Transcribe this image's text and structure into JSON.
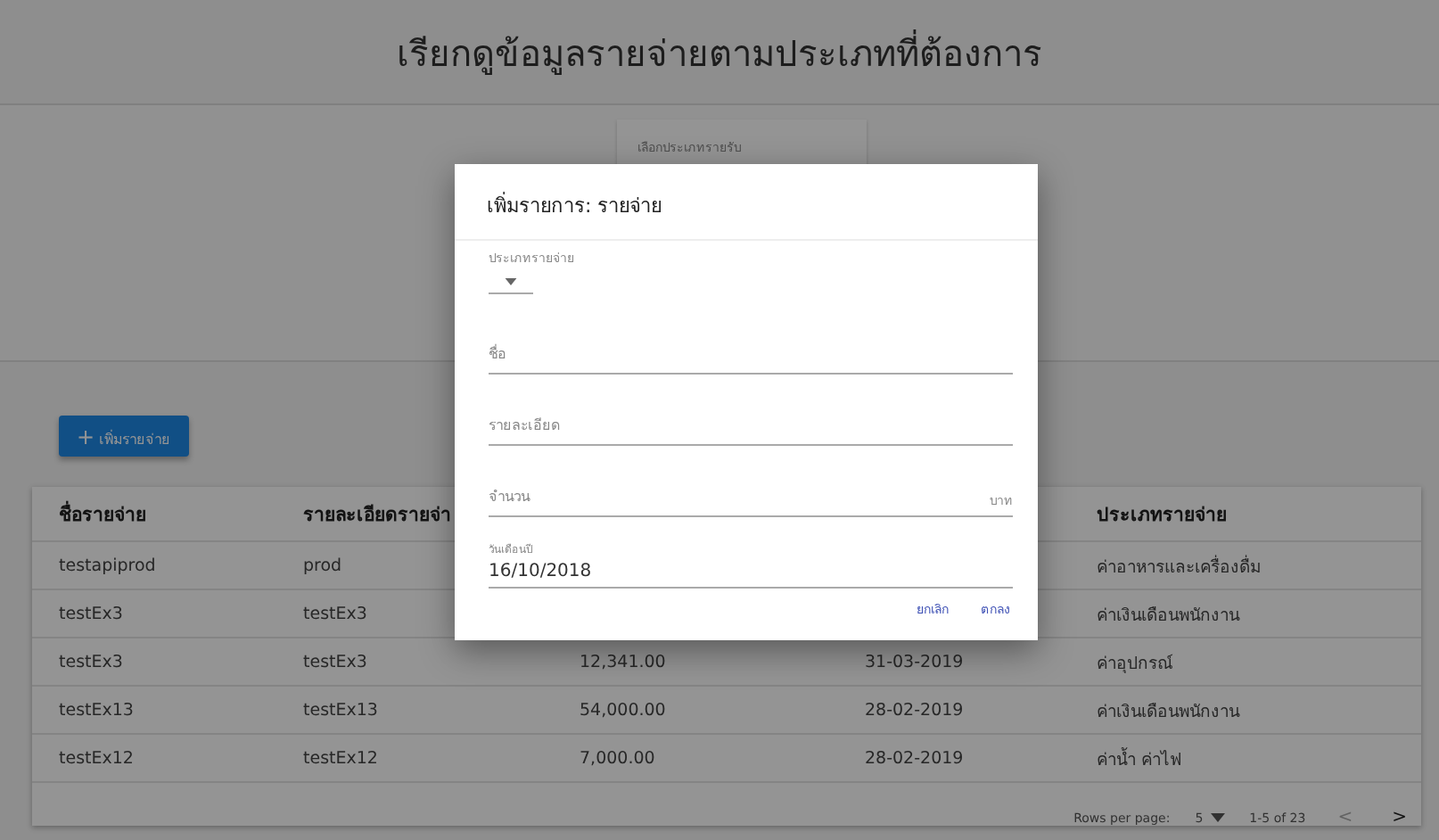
{
  "page_title": "เรียกดูข้อมูลรายจ่ายตามประเภทที่ต้องการ",
  "filter": {
    "label": "เลือกประเภทรายรับ"
  },
  "add_button": {
    "icon": "+",
    "label": "เพิ่มรายจ่าย"
  },
  "table": {
    "columns": [
      "ชื่อรายจ่าย",
      "รายละเอียดรายจ่า",
      null,
      null,
      "ประเภทรายจ่าย"
    ],
    "rows": [
      [
        "testapiprod",
        "prod",
        null,
        null,
        "ค่าอาหารและเครื่องดื่ม"
      ],
      [
        "testEx3",
        "testEx3",
        null,
        null,
        "ค่าเงินเดือนพนักงาน"
      ],
      [
        "testEx3",
        "testEx3",
        "12,341.00",
        "31-03-2019",
        "ค่าอุปกรณ์"
      ],
      [
        "testEx13",
        "testEx13",
        "54,000.00",
        "28-02-2019",
        "ค่าเงินเดือนพนักงาน"
      ],
      [
        "testEx12",
        "testEx12",
        "7,000.00",
        "28-02-2019",
        "ค่าน้ำ ค่าไฟ"
      ]
    ],
    "footer": {
      "rows_per_page_label": "Rows per page:",
      "rows_per_page": "5",
      "range": "1-5 of 23",
      "prev": "<",
      "next": ">"
    }
  },
  "dialog": {
    "title": "เพิ่มรายการ: รายจ่าย",
    "fields": [
      {
        "kind": "select",
        "label": "ประเภทรายจ่าย"
      },
      {
        "kind": "text",
        "placeholder": "ชื่อ"
      },
      {
        "kind": "text",
        "placeholder": "รายละเอียด"
      },
      {
        "kind": "text",
        "placeholder": "จำนวน",
        "suffix": "บาท"
      },
      {
        "kind": "date",
        "label": "วันเดือนปี",
        "value": "16/10/2018"
      }
    ],
    "buttons": [
      "ยกเลิก",
      "ตกลง"
    ]
  }
}
